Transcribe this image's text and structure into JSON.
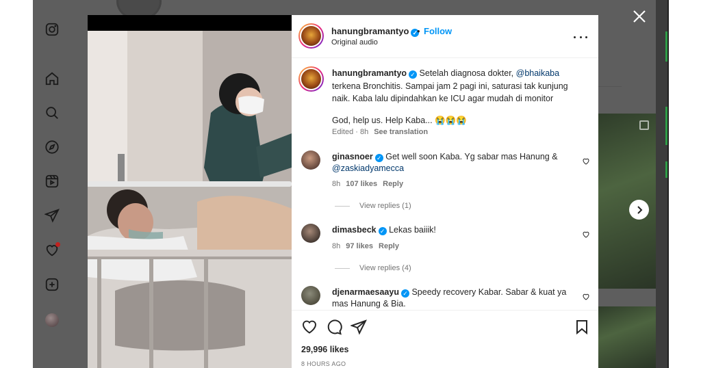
{
  "post": {
    "username": "hanungbramantyo",
    "follow_label": "Follow",
    "separator": "•",
    "audio": "Original audio",
    "caption_user": "hanungbramantyo",
    "caption_part1": "Setelah diagnosa dokter,",
    "caption_mention": "@bhaikaba",
    "caption_part2": "terkena Bronchitis. Sampai jam 2 pagi ini, saturasi tak kunjung naik. Kaba lalu dipindahkan ke ICU agar mudah di monitor",
    "caption_part3": "God, help us. Help Kaba... 😭😭😭",
    "caption_meta_time": "Edited · 8h",
    "see_translation": "See translation"
  },
  "comments": [
    {
      "username": "ginasnoer",
      "text": "Get well soon Kaba. Yg sabar mas Hanung &",
      "mention": "@zaskiadyamecca",
      "time": "8h",
      "likes": "107 likes",
      "reply": "Reply",
      "view_replies": "View replies (1)"
    },
    {
      "username": "dimasbeck",
      "text": "Lekas baiiik!",
      "time": "8h",
      "likes": "97 likes",
      "reply": "Reply",
      "view_replies": "View replies (4)"
    },
    {
      "username": "djenarmaesaayu",
      "text": "Speedy recovery Kabar. Sabar & kuat ya mas Hanung & Bia."
    }
  ],
  "footer": {
    "likes": "29,996 likes",
    "time": "8 HOURS AGO"
  },
  "icons": {
    "sidebar": [
      "instagram-icon",
      "home-icon",
      "search-icon",
      "explore-icon",
      "reels-icon",
      "send-icon",
      "heart-icon",
      "create-icon"
    ],
    "close": "close-icon",
    "next": "chevron-right-icon"
  },
  "colors": {
    "accent": "#0095f6",
    "overlay": "#5e5e5e",
    "notification": "#c0221f"
  }
}
